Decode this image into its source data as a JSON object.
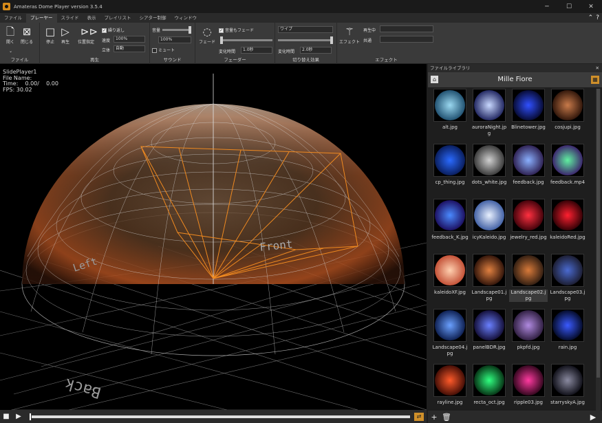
{
  "window": {
    "title": "Amateras Dome Player version 3.5.4",
    "minimize": "─",
    "maximize": "☐",
    "close": "✕"
  },
  "menu": {
    "tabs": [
      "ファイル",
      "プレーヤー",
      "スライド",
      "表示",
      "プレイリスト",
      "シアター制御",
      "ウィンドウ"
    ],
    "active": "プレーヤー",
    "collapse": "⌃",
    "help": "?"
  },
  "ribbon": {
    "file": {
      "label": "ファイル",
      "open": "開く",
      "close": "閉じる",
      "open_arrow": "⌄"
    },
    "play": {
      "label": "再生",
      "stop": "停止",
      "play": "再生",
      "position": "位置指定",
      "repeat": "繰り返し",
      "speed_label": "速度",
      "speed": "100%",
      "stereo_label": "立体",
      "stereo": "自動"
    },
    "sound": {
      "label": "サウンド",
      "volume_label": "音量",
      "volume": "100%",
      "mute": "ミュート"
    },
    "fader": {
      "label": "フェーダー",
      "fade": "フェード",
      "volume_fade": "音量もフェード",
      "change_label": "変化時間",
      "change_time": "1.0秒"
    },
    "transition": {
      "label": "切り替え効果",
      "mode": "ワイプ",
      "change_label": "変化時間",
      "change_time": "2.0秒"
    },
    "effect": {
      "label": "エフェクト",
      "button": "エフェクト",
      "playing_label": "再生中",
      "common_label": "共通"
    }
  },
  "viewport": {
    "player": "SlidePlayer1",
    "file": "File Name:",
    "time": "Time:    0.00/    0.00",
    "fps": "FPS: 30.02",
    "labels": {
      "front": "Front",
      "left": "Left",
      "back": "Back"
    }
  },
  "playbar": {
    "stop": "■",
    "play": "▶",
    "loop": "⇄"
  },
  "library": {
    "panel": "ファイルライブラリ",
    "close": "✕",
    "title": "Mille Fiore",
    "home": "⌂",
    "grid": "▦",
    "add": "+",
    "delete": "🗑",
    "play": "▶",
    "files": [
      {
        "name": "alt.jpg",
        "c1": "#9ad8f0",
        "c2": "#1b4b6b"
      },
      {
        "name": "auroraNight.jpg",
        "c1": "#c8d8ff",
        "c2": "#1a1f5a"
      },
      {
        "name": "Blinetower.jpg",
        "c1": "#3050ff",
        "c2": "#05082a"
      },
      {
        "name": "cosjupi.jpg",
        "c1": "#c87a4a",
        "c2": "#2a1208"
      },
      {
        "name": "cp_thing.jpg",
        "c1": "#2a6aff",
        "c2": "#081a55"
      },
      {
        "name": "dots_white.jpg",
        "c1": "#d0d0d0",
        "c2": "#333333"
      },
      {
        "name": "feedback.jpg",
        "c1": "#8ab0ff",
        "c2": "#2a1a4a"
      },
      {
        "name": "feedback.mp4",
        "c1": "#60f0a0",
        "c2": "#3a1a6a"
      },
      {
        "name": "feedback_K.jpg",
        "c1": "#4a8aff",
        "c2": "#1a0a5a"
      },
      {
        "name": "icyKaleido.jpg",
        "c1": "#e8f0ff",
        "c2": "#3a5aa0"
      },
      {
        "name": "jewelry_red.jpg",
        "c1": "#ff3040",
        "c2": "#3a0008"
      },
      {
        "name": "kaleidoRed.jpg",
        "c1": "#ff2030",
        "c2": "#2a0004"
      },
      {
        "name": "kaleidoXF.jpg",
        "c1": "#ffd0b0",
        "c2": "#c04a30"
      },
      {
        "name": "Landscape01.jpg",
        "c1": "#e08040",
        "c2": "#2a1008"
      },
      {
        "name": "Landscape02.jpg",
        "c1": "#d87a3a",
        "c2": "#2a1a10"
      },
      {
        "name": "Landscape03.jpg",
        "c1": "#4a6ad0",
        "c2": "#1a1a2a"
      },
      {
        "name": "Landscape04.jpg",
        "c1": "#6aa0ff",
        "c2": "#0a1a4a"
      },
      {
        "name": "panelBDR.jpg",
        "c1": "#6a80ff",
        "c2": "#100a30"
      },
      {
        "name": "pkpfd.jpg",
        "c1": "#b08ae0",
        "c2": "#2a1a3a"
      },
      {
        "name": "rain.jpg",
        "c1": "#3a5aff",
        "c2": "#020820"
      },
      {
        "name": "rayline.jpg",
        "c1": "#ff5a2a",
        "c2": "#3a0a04"
      },
      {
        "name": "recta_oct.jpg",
        "c1": "#30ff80",
        "c2": "#042a10"
      },
      {
        "name": "ripple03.jpg",
        "c1": "#ff3aa0",
        "c2": "#2a0418"
      },
      {
        "name": "starryskyA.jpg",
        "c1": "#8a8aa0",
        "c2": "#0a0a12"
      }
    ],
    "selected": "Landscape02.jpg"
  }
}
